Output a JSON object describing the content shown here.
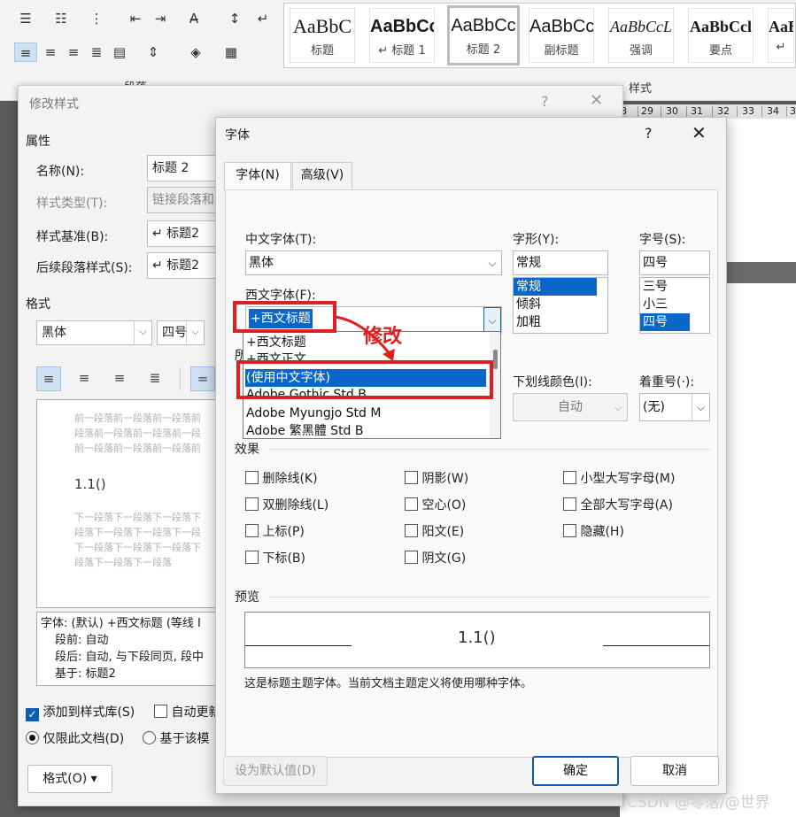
{
  "ribbon": {
    "groups": {
      "paragraph": "段落",
      "styles": "样式"
    },
    "styles": [
      {
        "sample": "AaBbC",
        "name": "标题"
      },
      {
        "sample": "AaBbCc",
        "name": "↵ 标题 1"
      },
      {
        "sample": "AaBbCc",
        "name": "标题 2"
      },
      {
        "sample": "AaBbCc",
        "name": "副标题"
      },
      {
        "sample": "AaBbCcL",
        "name": "强调"
      },
      {
        "sample": "AaBbCcl",
        "name": "要点"
      },
      {
        "sample": "AaB",
        "name": "↵"
      }
    ],
    "ruler": [
      "8",
      "29",
      "30",
      "31",
      "32",
      "33",
      "34",
      "3"
    ]
  },
  "modify": {
    "title": "修改样式",
    "section_props": "属性",
    "name_label": "名称(N):",
    "name_value": "标题 2",
    "type_label": "样式类型(T):",
    "type_value": "链接段落和",
    "based_label": "样式基准(B):",
    "based_value": "↵ 标题2",
    "next_label": "后续段落样式(S):",
    "next_value": "↵ 标题2",
    "section_format": "格式",
    "font_value": "黑体",
    "size_value": "四号",
    "preview_prev": [
      "前一段落前一段落前一段落前",
      "段落前一段落前一段落前一段",
      "前一段落前一段落前一段落前"
    ],
    "preview_heading": "1.1()",
    "preview_next": [
      "下一段落下一段落下一段落下",
      "段落下一段落下一段落下一段",
      "下一段落下一段落下一段落下",
      "段落下一段落下一段落"
    ],
    "desc_lines": [
      "字体: (默认) +西文标题 (等线 I",
      "段前: 自动",
      "段后: 自动, 与下段同页, 段中",
      "基于: 标题2"
    ],
    "add_gallery": "添加到样式库(S)",
    "auto_update": "自动更新",
    "only_doc": "仅限此文档(D)",
    "based_template": "基于该模",
    "format_button": "格式(O) ▾"
  },
  "font_dialog": {
    "title": "字体",
    "tabs": [
      "字体(N)",
      "高级(V)"
    ],
    "cn_font_label": "中文字体(T):",
    "cn_font_value": "黑体",
    "style_label": "字形(Y):",
    "style_value": "常规",
    "style_options": [
      "常规",
      "倾斜",
      "加粗"
    ],
    "size_label": "字号(S):",
    "size_value": "四号",
    "size_options": [
      "三号",
      "小三",
      "四号"
    ],
    "west_font_label": "西文字体(F):",
    "west_font_value": "+西文标题",
    "dropdown_items": [
      "+西文标题",
      "+西文正文",
      "(使用中文字体)",
      "Adobe Gothic Std B",
      "Adobe Myungjo Std M",
      "Adobe 繁黑體 Std B"
    ],
    "all_text_label": "所",
    "underline_color_label": "下划线颜色(I):",
    "underline_color_value": "自动",
    "emphasis_label": "着重号(·):",
    "emphasis_value": "(无)",
    "effects_label": "效果",
    "effects": [
      "删除线(K)",
      "阴影(W)",
      "小型大写字母(M)",
      "双删除线(L)",
      "空心(O)",
      "全部大写字母(A)",
      "上标(P)",
      "阳文(E)",
      "隐藏(H)",
      "下标(B)",
      "阴文(G)"
    ],
    "preview_label": "预览",
    "preview_text": "1.1()",
    "preview_note": "这是标题主题字体。当前文档主题定义将使用哪种字体。",
    "default_button": "设为默认值(D)",
    "ok_button": "确定",
    "cancel_button": "取消"
  },
  "annotation": {
    "text": "修改",
    "color": "#e02020"
  },
  "watermark": "CSDN @零落/@世界",
  "colors": {
    "accent": "#0b67c7",
    "annotation": "#e02020"
  }
}
